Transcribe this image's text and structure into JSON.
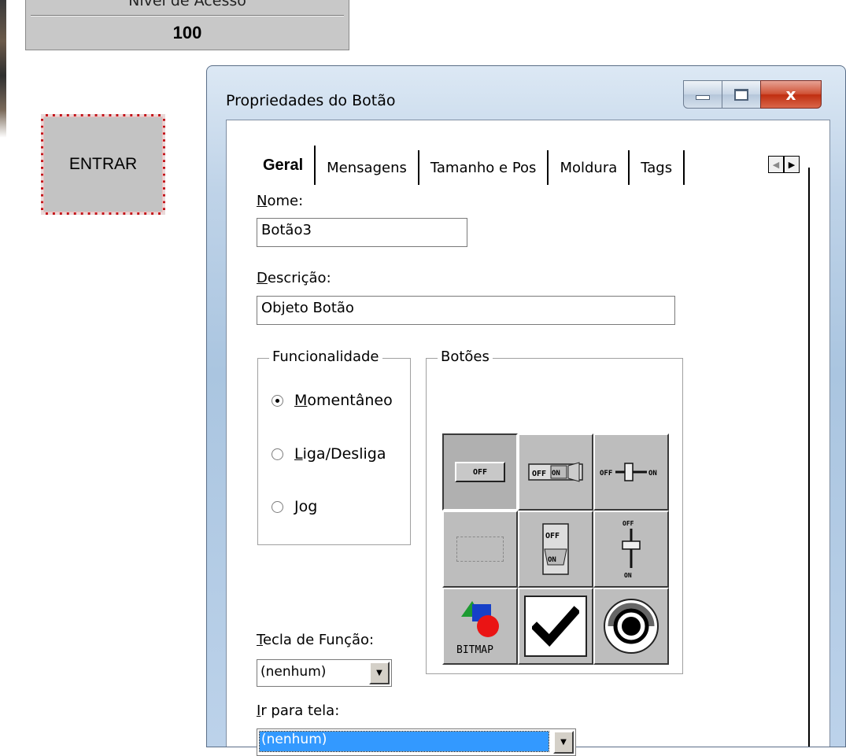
{
  "canvas": {
    "access_panel": {
      "label": "Nível de Acesso",
      "value": "100"
    },
    "entrar_button": {
      "label": "ENTRAR"
    }
  },
  "dialog": {
    "title": "Propriedades do Botão",
    "window_controls": {
      "close_glyph": "x"
    },
    "tabs": [
      {
        "label": "Geral",
        "active": true
      },
      {
        "label": "Mensagens"
      },
      {
        "label": "Tamanho e Pos"
      },
      {
        "label": "Moldura"
      },
      {
        "label": "Tags"
      }
    ],
    "nome": {
      "label_accel": "N",
      "label_rest": "ome:",
      "value": "Botão3"
    },
    "descricao": {
      "label_accel": "D",
      "label_rest": "escrição:",
      "value": "Objeto Botão"
    },
    "funcionalidade": {
      "title": "Funcionalidade",
      "options": [
        {
          "accel": "M",
          "rest": "omentâneo",
          "checked": true
        },
        {
          "accel": "L",
          "rest": "iga/Desliga",
          "checked": false
        },
        {
          "accel": "J",
          "rest": "og",
          "checked": false
        }
      ]
    },
    "botoes": {
      "title": "Botões",
      "styles": [
        "OFF",
        "OFF ON",
        "OFF ON slider",
        "blank",
        "OFF ON vertical",
        "OFF ON vertical slider",
        "BITMAP",
        "checkbox",
        "radio"
      ],
      "selected": "OFF",
      "labels": {
        "off": "OFF",
        "on": "ON",
        "bitmap": "BITMAP"
      }
    },
    "tecla_funcao": {
      "label_accel": "T",
      "label_rest": "ecla de Função:",
      "value": "(nenhum)"
    },
    "ir_para_tela": {
      "label_accel": "I",
      "label_rest": "r para tela:",
      "value": "(nenhum)"
    }
  }
}
